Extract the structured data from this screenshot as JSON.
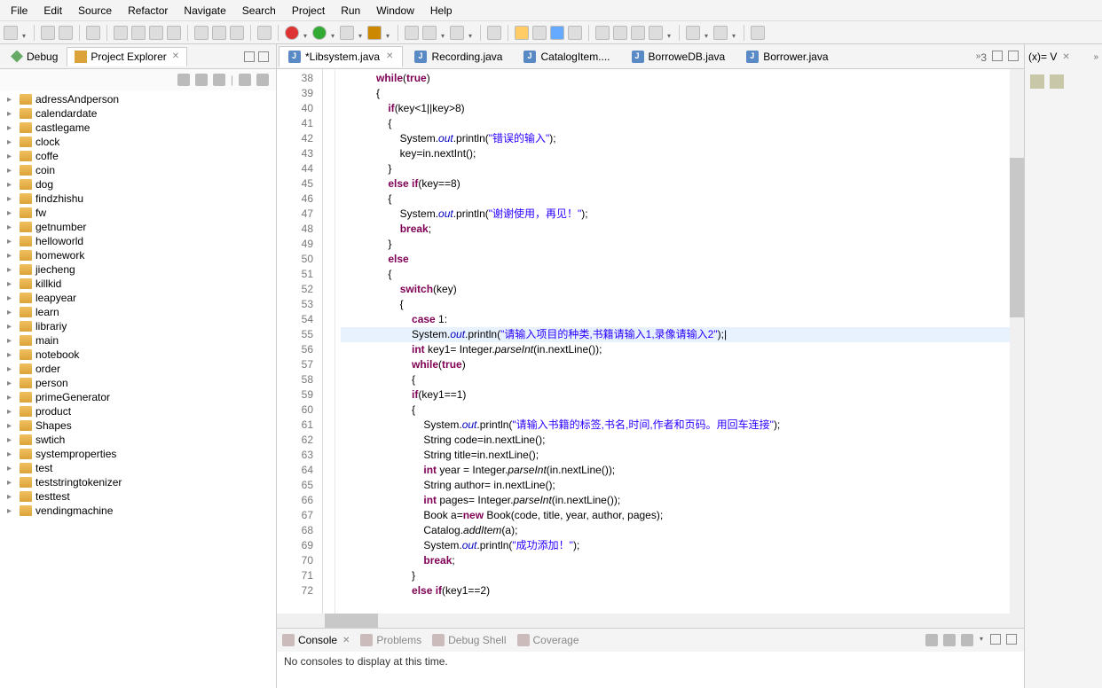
{
  "menu": [
    "File",
    "Edit",
    "Source",
    "Refactor",
    "Navigate",
    "Search",
    "Project",
    "Run",
    "Window",
    "Help"
  ],
  "leftTabs": [
    {
      "label": "Debug",
      "active": false
    },
    {
      "label": "Project Explorer",
      "active": true
    }
  ],
  "projects": [
    "adressAndperson",
    "calendardate",
    "castlegame",
    "clock",
    "coffe",
    "coin",
    "dog",
    "findzhishu",
    "fw",
    "getnumber",
    "helloworld",
    "homework",
    "jiecheng",
    "killkid",
    "leapyear",
    "learn",
    "librariy",
    "main",
    "notebook",
    "order",
    "person",
    "primeGenerator",
    "product",
    "Shapes",
    "swtich",
    "systemproperties",
    "test",
    "teststringtokenizer",
    "testtest",
    "vendingmachine"
  ],
  "editorTabs": [
    {
      "label": "*Libsystem.java",
      "active": true
    },
    {
      "label": "Recording.java",
      "active": false
    },
    {
      "label": "CatalogItem....",
      "active": false
    },
    {
      "label": "BorroweDB.java",
      "active": false
    },
    {
      "label": "Borrower.java",
      "active": false
    }
  ],
  "overflowCount": "3",
  "lineStart": 38,
  "lineEnd": 72,
  "highlightLine": 55,
  "code": {
    "l38": {
      "pre": "            ",
      "kw": "while",
      "mid": "(",
      "kw2": "true",
      "end": ")"
    },
    "l39": {
      "pre": "            {"
    },
    "l40": {
      "pre": "                ",
      "kw": "if",
      "end": "(key<1||key>8)"
    },
    "l41": {
      "pre": "                {"
    },
    "l42": {
      "pre": "                    System.",
      "fld": "out",
      "mid": ".println(",
      "str": "\"错误的输入\"",
      "end": ");"
    },
    "l43": {
      "pre": "                    key=in.nextInt();"
    },
    "l44": {
      "pre": "                }"
    },
    "l45": {
      "pre": "                ",
      "kw": "else if",
      "end": "(key==8)"
    },
    "l46": {
      "pre": "                {"
    },
    "l47": {
      "pre": "                    System.",
      "fld": "out",
      "mid": ".println(",
      "str": "\"谢谢使用，再见！\"",
      "end": ");"
    },
    "l48": {
      "pre": "                    ",
      "kw": "break",
      "end": ";"
    },
    "l49": {
      "pre": "                }"
    },
    "l50": {
      "pre": "                ",
      "kw": "else"
    },
    "l51": {
      "pre": "                {"
    },
    "l52": {
      "pre": "                    ",
      "kw": "switch",
      "end": "(key)"
    },
    "l53": {
      "pre": "                    {"
    },
    "l54": {
      "pre": "                        ",
      "kw": "case",
      "end": " 1:"
    },
    "l55": {
      "pre": "                        System.",
      "fld": "out",
      "mid": ".println(",
      "str": "\"请输入项目的种类,书籍请输入1,录像请输入2\"",
      "end": ");|"
    },
    "l56": {
      "pre": "                        ",
      "kw": "int",
      "mid": " key1= Integer.",
      "mtd": "parseInt",
      "end": "(in.nextLine());"
    },
    "l57": {
      "pre": "                        ",
      "kw": "while",
      "mid": "(",
      "kw2": "true",
      "end": ")"
    },
    "l58": {
      "pre": "                        {"
    },
    "l59": {
      "pre": "                        ",
      "kw": "if",
      "end": "(key1==1)"
    },
    "l60": {
      "pre": "                        {"
    },
    "l61": {
      "pre": "                            System.",
      "fld": "out",
      "mid": ".println(",
      "str": "\"请输入书籍的标签,书名,时间,作者和页码。用回车连接\"",
      "end": ");"
    },
    "l62": {
      "pre": "                            String code=in.nextLine();"
    },
    "l63": {
      "pre": "                            String title=in.nextLine();"
    },
    "l64": {
      "pre": "                            ",
      "kw": "int",
      "mid": " year = Integer.",
      "mtd": "parseInt",
      "end": "(in.nextLine());"
    },
    "l65": {
      "pre": "                            String author= in.nextLine();"
    },
    "l66": {
      "pre": "                            ",
      "kw": "int",
      "mid": " pages= Integer.",
      "mtd": "parseInt",
      "end": "(in.nextLine());"
    },
    "l67": {
      "pre": "                            Book a=",
      "kw": "new",
      "end": " Book(code, title, year, author, pages);"
    },
    "l68": {
      "pre": "                            Catalog.",
      "mtd": "addItem",
      "end": "(a);"
    },
    "l69": {
      "pre": "                            System.",
      "fld": "out",
      "mid": ".println(",
      "str": "\"成功添加！\"",
      "end": ");"
    },
    "l70": {
      "pre": "                            ",
      "kw": "break",
      "end": ";"
    },
    "l71": {
      "pre": "                        }"
    },
    "l72": {
      "pre": "                        ",
      "kw": "else if",
      "end": "(key1==2)"
    }
  },
  "bottomTabs": [
    {
      "label": "Console",
      "active": true
    },
    {
      "label": "Problems",
      "active": false
    },
    {
      "label": "Debug Shell",
      "active": false
    },
    {
      "label": "Coverage",
      "active": false
    }
  ],
  "consoleMsg": "No consoles to display at this time.",
  "rightTab": "(x)= V"
}
